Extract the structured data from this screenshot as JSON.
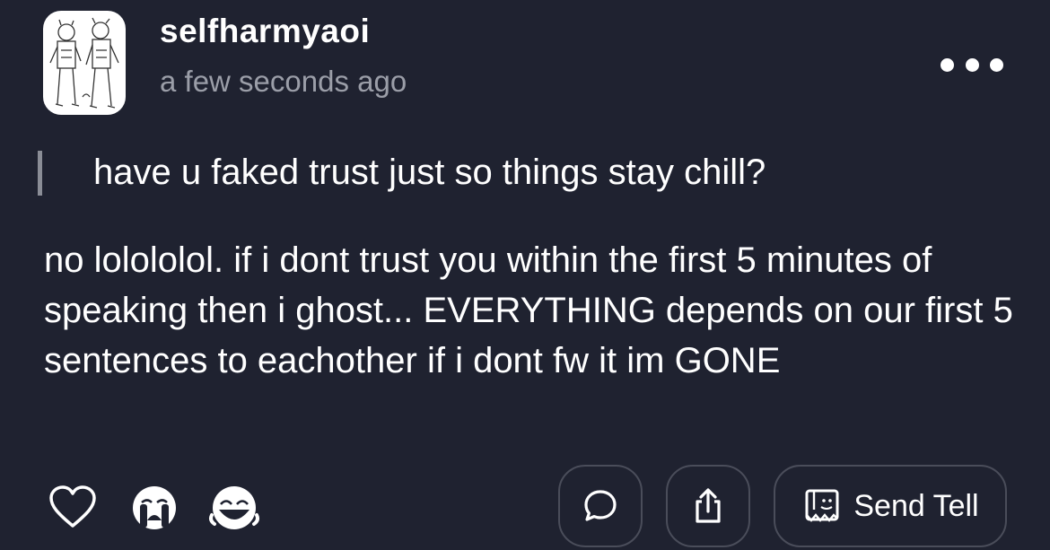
{
  "post": {
    "username": "selfharmyaoi",
    "timestamp": "a few seconds ago",
    "question": "have u faked trust just so things stay chill?",
    "answer": "no lolololol. if i dont trust you within the first 5 minutes of speaking then i ghost... EVERYTHING depends on our first 5 sentences to eachother if i dont fw it im GONE"
  },
  "actions": {
    "reactions": [
      "heart-icon",
      "crying-face-icon",
      "laughing-face-icon"
    ],
    "send_tell_label": "Send Tell"
  },
  "colors": {
    "background": "#1f2230",
    "text": "#ffffff",
    "muted": "#9b9ea8",
    "border": "#4a4d5a"
  }
}
